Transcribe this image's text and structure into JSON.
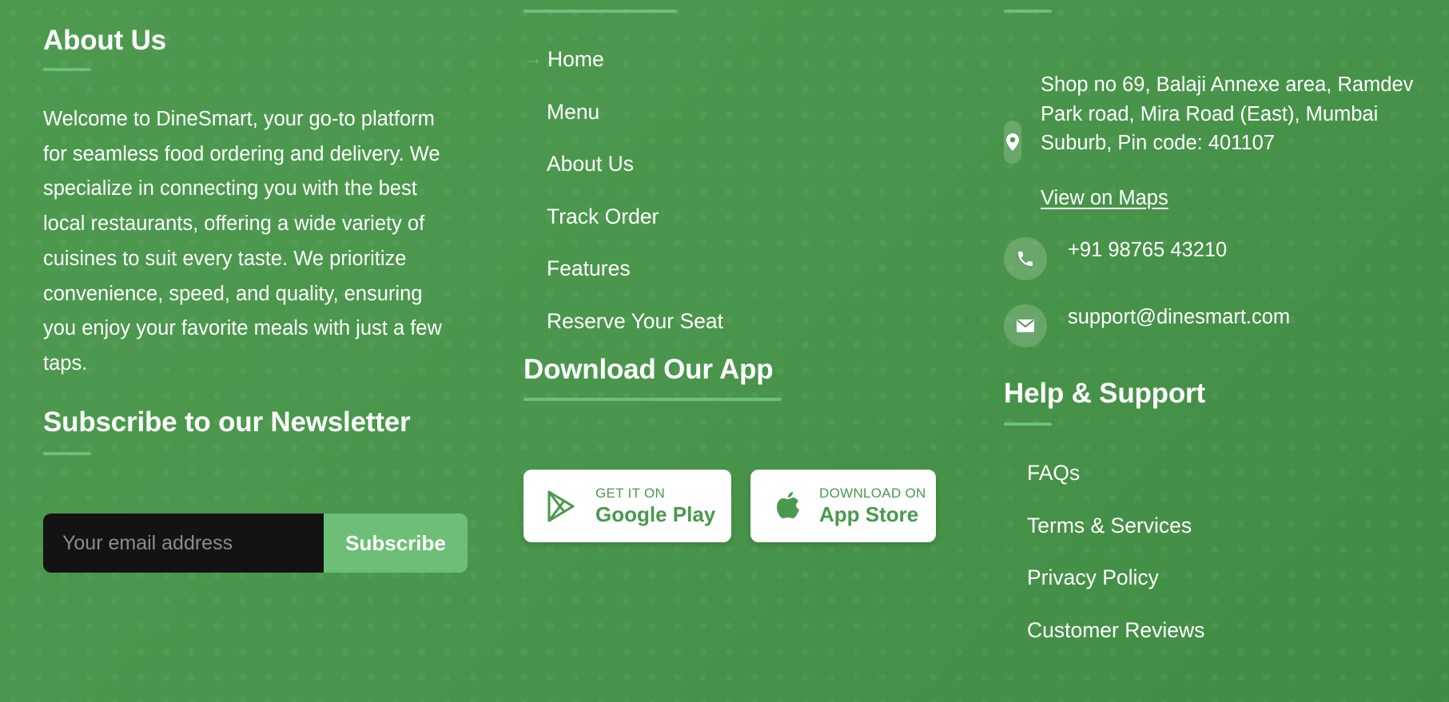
{
  "about": {
    "heading": "About Us",
    "text": "Welcome to DineSmart, your go-to platform for seamless food ordering and delivery. We specialize in connecting you with the best local restaurants, offering a wide variety of cuisines to suit every taste. We prioritize convenience, speed, and quality, ensuring you enjoy your favorite meals with just a few taps."
  },
  "newsletter": {
    "heading": "Subscribe to our Newsletter",
    "placeholder": "Your email address",
    "button_label": "Subscribe"
  },
  "quick_links": {
    "items": [
      {
        "label": "Home"
      },
      {
        "label": "Menu"
      },
      {
        "label": "About Us"
      },
      {
        "label": "Track Order"
      },
      {
        "label": "Features"
      },
      {
        "label": "Reserve Your Seat"
      }
    ]
  },
  "app": {
    "heading": "Download Our App",
    "google": {
      "small": "GET IT ON",
      "big": "Google Play",
      "icon": "google-play-icon"
    },
    "apple": {
      "small": "DOWNLOAD ON",
      "big": "App Store",
      "icon": "apple-icon"
    }
  },
  "contact": {
    "address": "Shop no 69, Balaji Annexe area, Ramdev Park road, Mira Road (East), Mumbai Suburb, Pin code: 401107",
    "maps_link": "View on Maps",
    "phone": "+91 98765 43210",
    "email": "support@dinesmart.com",
    "icons": {
      "address": "map-pin-icon",
      "phone": "phone-icon",
      "email": "envelope-icon"
    }
  },
  "help": {
    "heading": "Help & Support",
    "items": [
      {
        "label": "FAQs"
      },
      {
        "label": "Terms & Services"
      },
      {
        "label": "Privacy Policy"
      },
      {
        "label": "Customer Reviews"
      }
    ]
  },
  "colors": {
    "background": "#4a964c",
    "accent": "#6cc17a",
    "input_background": "#131313",
    "store_text": "#4a994e"
  }
}
